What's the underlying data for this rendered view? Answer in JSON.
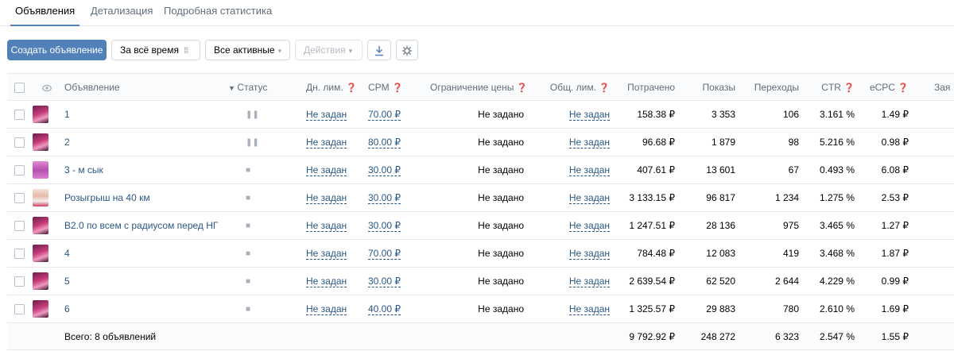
{
  "tabs": [
    {
      "label": "Объявления"
    },
    {
      "label": "Детализация"
    },
    {
      "label": "Подробная статистика"
    }
  ],
  "toolbar": {
    "create_label": "Создать объявление",
    "period_label": "За всё время",
    "filter_label": "Все активные",
    "actions_label": "Действия"
  },
  "headers": {
    "name": "Объявление",
    "status": "Статус",
    "dn_lim": "Дн. лим.",
    "cpm": "CPM",
    "price_limit": "Ограничение цены",
    "total_lim": "Общ. лим.",
    "spent": "Потрачено",
    "shows": "Показы",
    "clicks": "Переходы",
    "ctr": "CTR",
    "ecpc": "eCPC",
    "extra": "Зая"
  },
  "rows": [
    {
      "name": "1",
      "status": "paused",
      "dn": "Не задан",
      "cpm": "70.00 ₽",
      "lim": "Не задано",
      "obsh": "Не задан",
      "spent": "158.38 ₽",
      "shows": "3 353",
      "clicks": "106",
      "ctr": "3.161 %",
      "ecpc": "1.49 ₽"
    },
    {
      "name": "2",
      "status": "paused",
      "dn": "Не задан",
      "cpm": "80.00 ₽",
      "lim": "Не задано",
      "obsh": "Не задан",
      "spent": "96.68 ₽",
      "shows": "1 879",
      "clicks": "98",
      "ctr": "5.216 %",
      "ecpc": "0.98 ₽"
    },
    {
      "name": "3 - м сык",
      "status": "stopped",
      "dn": "Не задан",
      "cpm": "30.00 ₽",
      "lim": "Не задано",
      "obsh": "Не задан",
      "spent": "407.61 ₽",
      "shows": "13 601",
      "clicks": "67",
      "ctr": "0.493 %",
      "ecpc": "6.08 ₽"
    },
    {
      "name": "Розыгрыш на 40 км",
      "status": "stopped",
      "dn": "Не задан",
      "cpm": "30.00 ₽",
      "lim": "Не задано",
      "obsh": "Не задан",
      "spent": "3 133.15 ₽",
      "shows": "96 817",
      "clicks": "1 234",
      "ctr": "1.275 %",
      "ecpc": "2.53 ₽"
    },
    {
      "name": "В2.0 по всем с радиусом перед НГ",
      "status": "stopped",
      "dn": "Не задан",
      "cpm": "30.00 ₽",
      "lim": "Не задано",
      "obsh": "Не задан",
      "spent": "1 247.51 ₽",
      "shows": "28 136",
      "clicks": "975",
      "ctr": "3.465 %",
      "ecpc": "1.27 ₽"
    },
    {
      "name": "4",
      "status": "stopped",
      "dn": "Не задан",
      "cpm": "70.00 ₽",
      "lim": "Не задано",
      "obsh": "Не задан",
      "spent": "784.48 ₽",
      "shows": "12 083",
      "clicks": "419",
      "ctr": "3.468 %",
      "ecpc": "1.87 ₽"
    },
    {
      "name": "5",
      "status": "stopped",
      "dn": "Не задан",
      "cpm": "30.00 ₽",
      "lim": "Не задано",
      "obsh": "Не задан",
      "spent": "2 639.54 ₽",
      "shows": "62 520",
      "clicks": "2 644",
      "ctr": "4.229 %",
      "ecpc": "0.99 ₽"
    },
    {
      "name": "6",
      "status": "stopped",
      "dn": "Не задан",
      "cpm": "40.00 ₽",
      "lim": "Не задано",
      "obsh": "Не задан",
      "spent": "1 325.57 ₽",
      "shows": "29 883",
      "clicks": "780",
      "ctr": "2.610 %",
      "ecpc": "1.69 ₽"
    }
  ],
  "total": {
    "label": "Всего: 8 объявлений",
    "spent": "9 792.92 ₽",
    "shows": "248 272",
    "clicks": "6 323",
    "ctr": "2.547 %",
    "ecpc": "1.55 ₽"
  },
  "colors": {
    "accent": "#5181b8",
    "link": "#2a5885",
    "muted": "#626d7a",
    "border": "#e7e8ec"
  },
  "icons": {
    "paused": "pause-icon",
    "stopped": "stop-icon",
    "help": "question-circle-icon",
    "download": "download-icon",
    "settings": "gear-icon",
    "view": "eye-icon"
  }
}
